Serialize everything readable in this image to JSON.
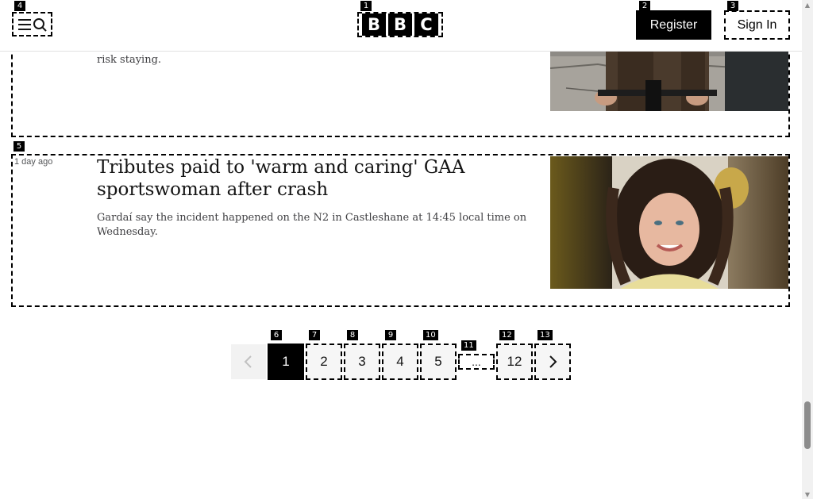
{
  "header": {
    "logo_letters": [
      "B",
      "B",
      "C"
    ],
    "register_label": "Register",
    "signin_label": "Sign In",
    "menu_icon": "menu-search-icon"
  },
  "overlay_tags": {
    "logo": "1",
    "register": "2",
    "signin": "3",
    "menu": "4",
    "article": "5",
    "page_1": "6",
    "page_2": "7",
    "page_3": "8",
    "page_4": "9",
    "page_5": "10",
    "ellipsis": "11",
    "page_12": "12",
    "next": "13"
  },
  "articles": [
    {
      "summary_tail": "risk staying.",
      "image": "man-on-bicycle-photo"
    },
    {
      "timestamp": "1 day ago",
      "headline": "Tributes paid to 'warm and caring' GAA sportswoman after crash",
      "summary": "Gardaí say the incident happened on the N2 in Castleshane at 14:45 local time on Wednesday.",
      "image": "woman-portrait-photo"
    }
  ],
  "pagination": {
    "prev_icon": "chevron-left-icon",
    "pages": [
      "1",
      "2",
      "3",
      "4",
      "5"
    ],
    "ellipsis": "...",
    "last_page": "12",
    "next_icon": "chevron-right-icon",
    "current_page": "1"
  },
  "colors": {
    "brand": "#000000",
    "background": "#ffffff",
    "pager_bg": "#f6f6f6"
  }
}
